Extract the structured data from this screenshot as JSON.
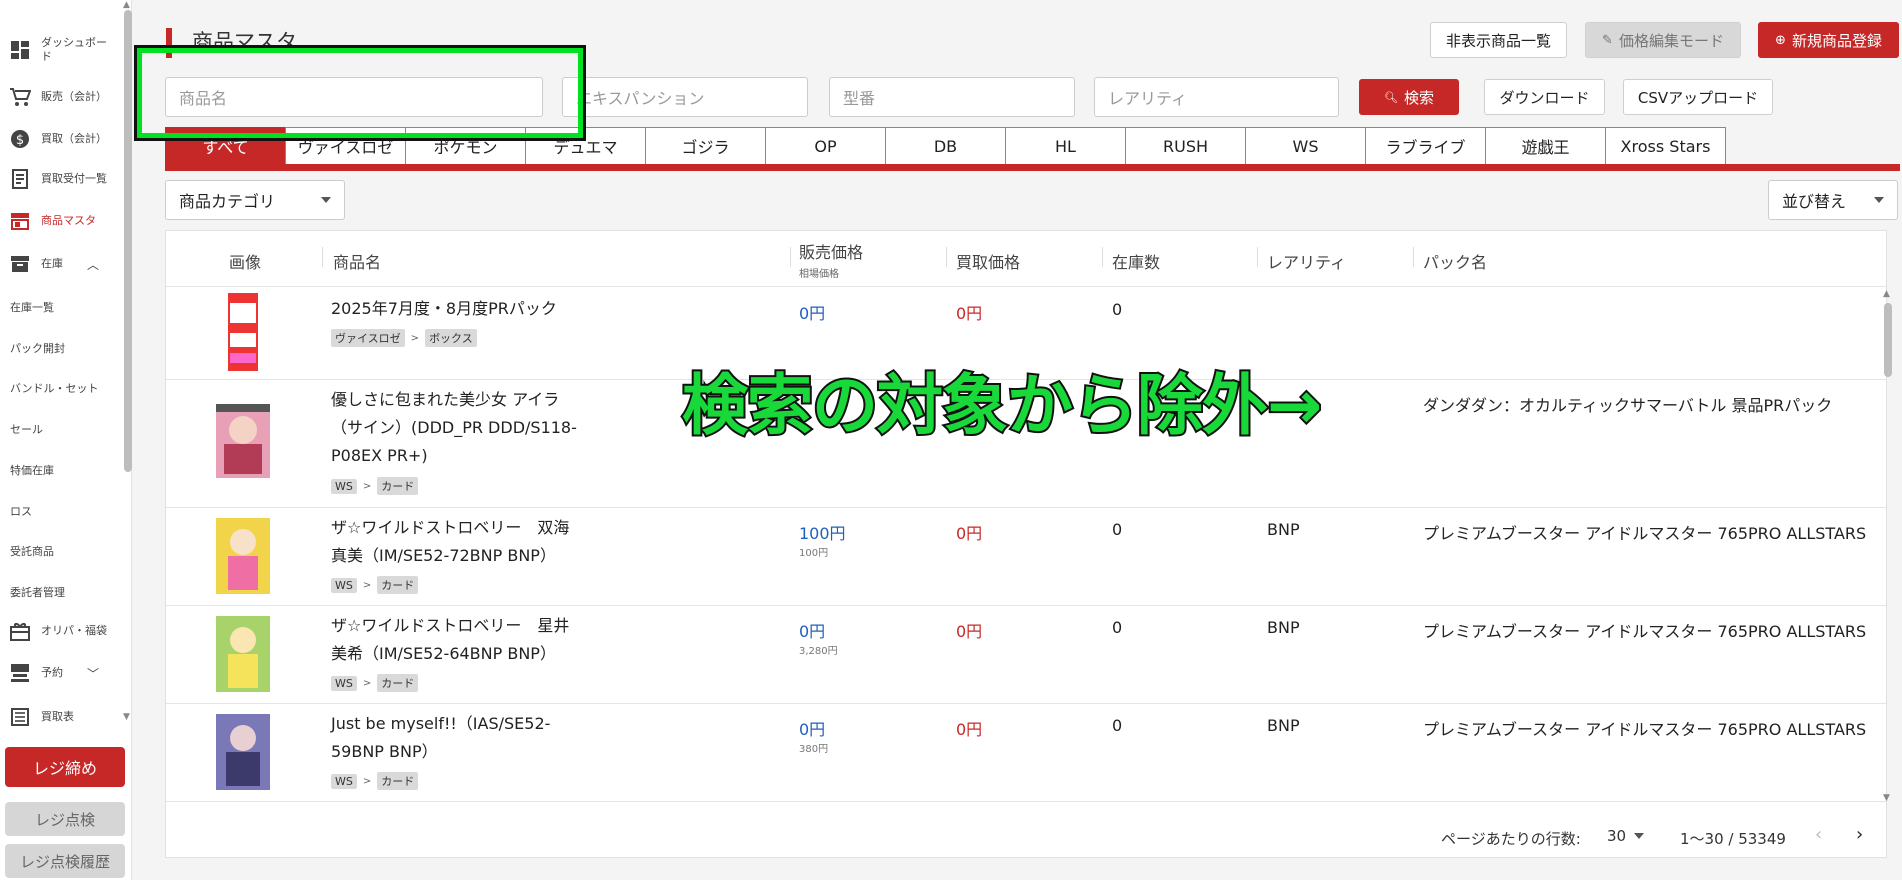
{
  "sidebar": {
    "items": [
      {
        "label": "ダッシュボード",
        "icon": "dashboard-icon"
      },
      {
        "label": "販売（会計）",
        "icon": "cart-icon"
      },
      {
        "label": "買取（会計）",
        "icon": "dollar-icon"
      },
      {
        "label": "買取受付一覧",
        "icon": "receipt-icon"
      },
      {
        "label": "商品マスタ",
        "icon": "store-icon"
      },
      {
        "label": "在庫",
        "icon": "inventory-icon"
      }
    ],
    "sub_items": [
      "在庫一覧",
      "パック開封",
      "バンドル・セット",
      "セール",
      "特価在庫",
      "ロス",
      "受託商品",
      "委託者管理"
    ],
    "items2": [
      {
        "label": "オリパ・福袋",
        "icon": "gift-icon"
      },
      {
        "label": "予約",
        "icon": "register-icon"
      },
      {
        "label": "買取表",
        "icon": "list-icon"
      }
    ],
    "close_register": "レジ締め",
    "register_check": "レジ点検",
    "register_history": "レジ点検履歴"
  },
  "header": {
    "title": "商品マスタ",
    "hidden_products": "非表示商品一覧",
    "price_edit_mode": "価格編集モード",
    "new_product": "新規商品登録"
  },
  "search": {
    "name_placeholder": "商品名",
    "expansion_placeholder": "エキスパンション",
    "model_placeholder": "型番",
    "rarity_placeholder": "レアリティ",
    "search_button": "検索",
    "download_button": "ダウンロード",
    "csv_upload_button": "CSVアップロード"
  },
  "tabs": [
    "すべて",
    "ヴァイスロゼ",
    "ポケモン",
    "デュエマ",
    "ゴジラ",
    "OP",
    "DB",
    "HL",
    "RUSH",
    "WS",
    "ラブライブ",
    "遊戯王",
    "Xross Stars"
  ],
  "filters": {
    "category": "商品カテゴリ",
    "sort": "並び替え"
  },
  "table": {
    "headers": {
      "image": "画像",
      "name": "商品名",
      "sell_price": "販売価格",
      "sell_price_sub": "相場価格",
      "buy_price": "買取価格",
      "stock": "在庫数",
      "rarity": "レアリティ",
      "pack": "パック名"
    },
    "rows": [
      {
        "name": "2025年7月度・8月度PRパック",
        "tag1": "ヴァイスロゼ",
        "tag2": "ボックス",
        "sell": "0円",
        "sell_sub": "",
        "buy": "0円",
        "stock": "0",
        "rarity": "",
        "pack": ""
      },
      {
        "name": "優しさに包まれた美少女 アイラ（サイン）(DDD_PR DDD/S118-P08EX PR+)",
        "tag1": "WS",
        "tag2": "カード",
        "sell": "",
        "sell_sub": "",
        "buy": "",
        "stock": "",
        "rarity": "",
        "pack": "ダンダダン：オカルティックサマーバトル 景品PRパック"
      },
      {
        "name": "ザ☆ワイルドストロベリー　双海真美（IM/SE52-72BNP BNP）",
        "tag1": "WS",
        "tag2": "カード",
        "sell": "100円",
        "sell_sub": "100円",
        "buy": "0円",
        "stock": "0",
        "rarity": "BNP",
        "pack": "プレミアムブースター アイドルマスター 765PRO ALLSTARS"
      },
      {
        "name": "ザ☆ワイルドストロベリー　星井美希（IM/SE52-64BNP BNP）",
        "tag1": "WS",
        "tag2": "カード",
        "sell": "0円",
        "sell_sub": "3,280円",
        "buy": "0円",
        "stock": "0",
        "rarity": "BNP",
        "pack": "プレミアムブースター アイドルマスター 765PRO ALLSTARS"
      },
      {
        "name": "Just be myself!!（IAS/SE52-59BNP BNP）",
        "tag1": "WS",
        "tag2": "カード",
        "sell": "0円",
        "sell_sub": "380円",
        "buy": "0円",
        "stock": "0",
        "rarity": "BNP",
        "pack": "プレミアムブースター アイドルマスター 765PRO ALLSTARS"
      }
    ]
  },
  "pagination": {
    "rows_label": "ページあたりの行数:",
    "rows_value": "30",
    "range": "1〜30 / 53349"
  },
  "annotation": "検索の対象から除外→",
  "colors": {
    "accent": "#c62828",
    "highlight": "#00e220",
    "link": "#1f5fbf"
  }
}
